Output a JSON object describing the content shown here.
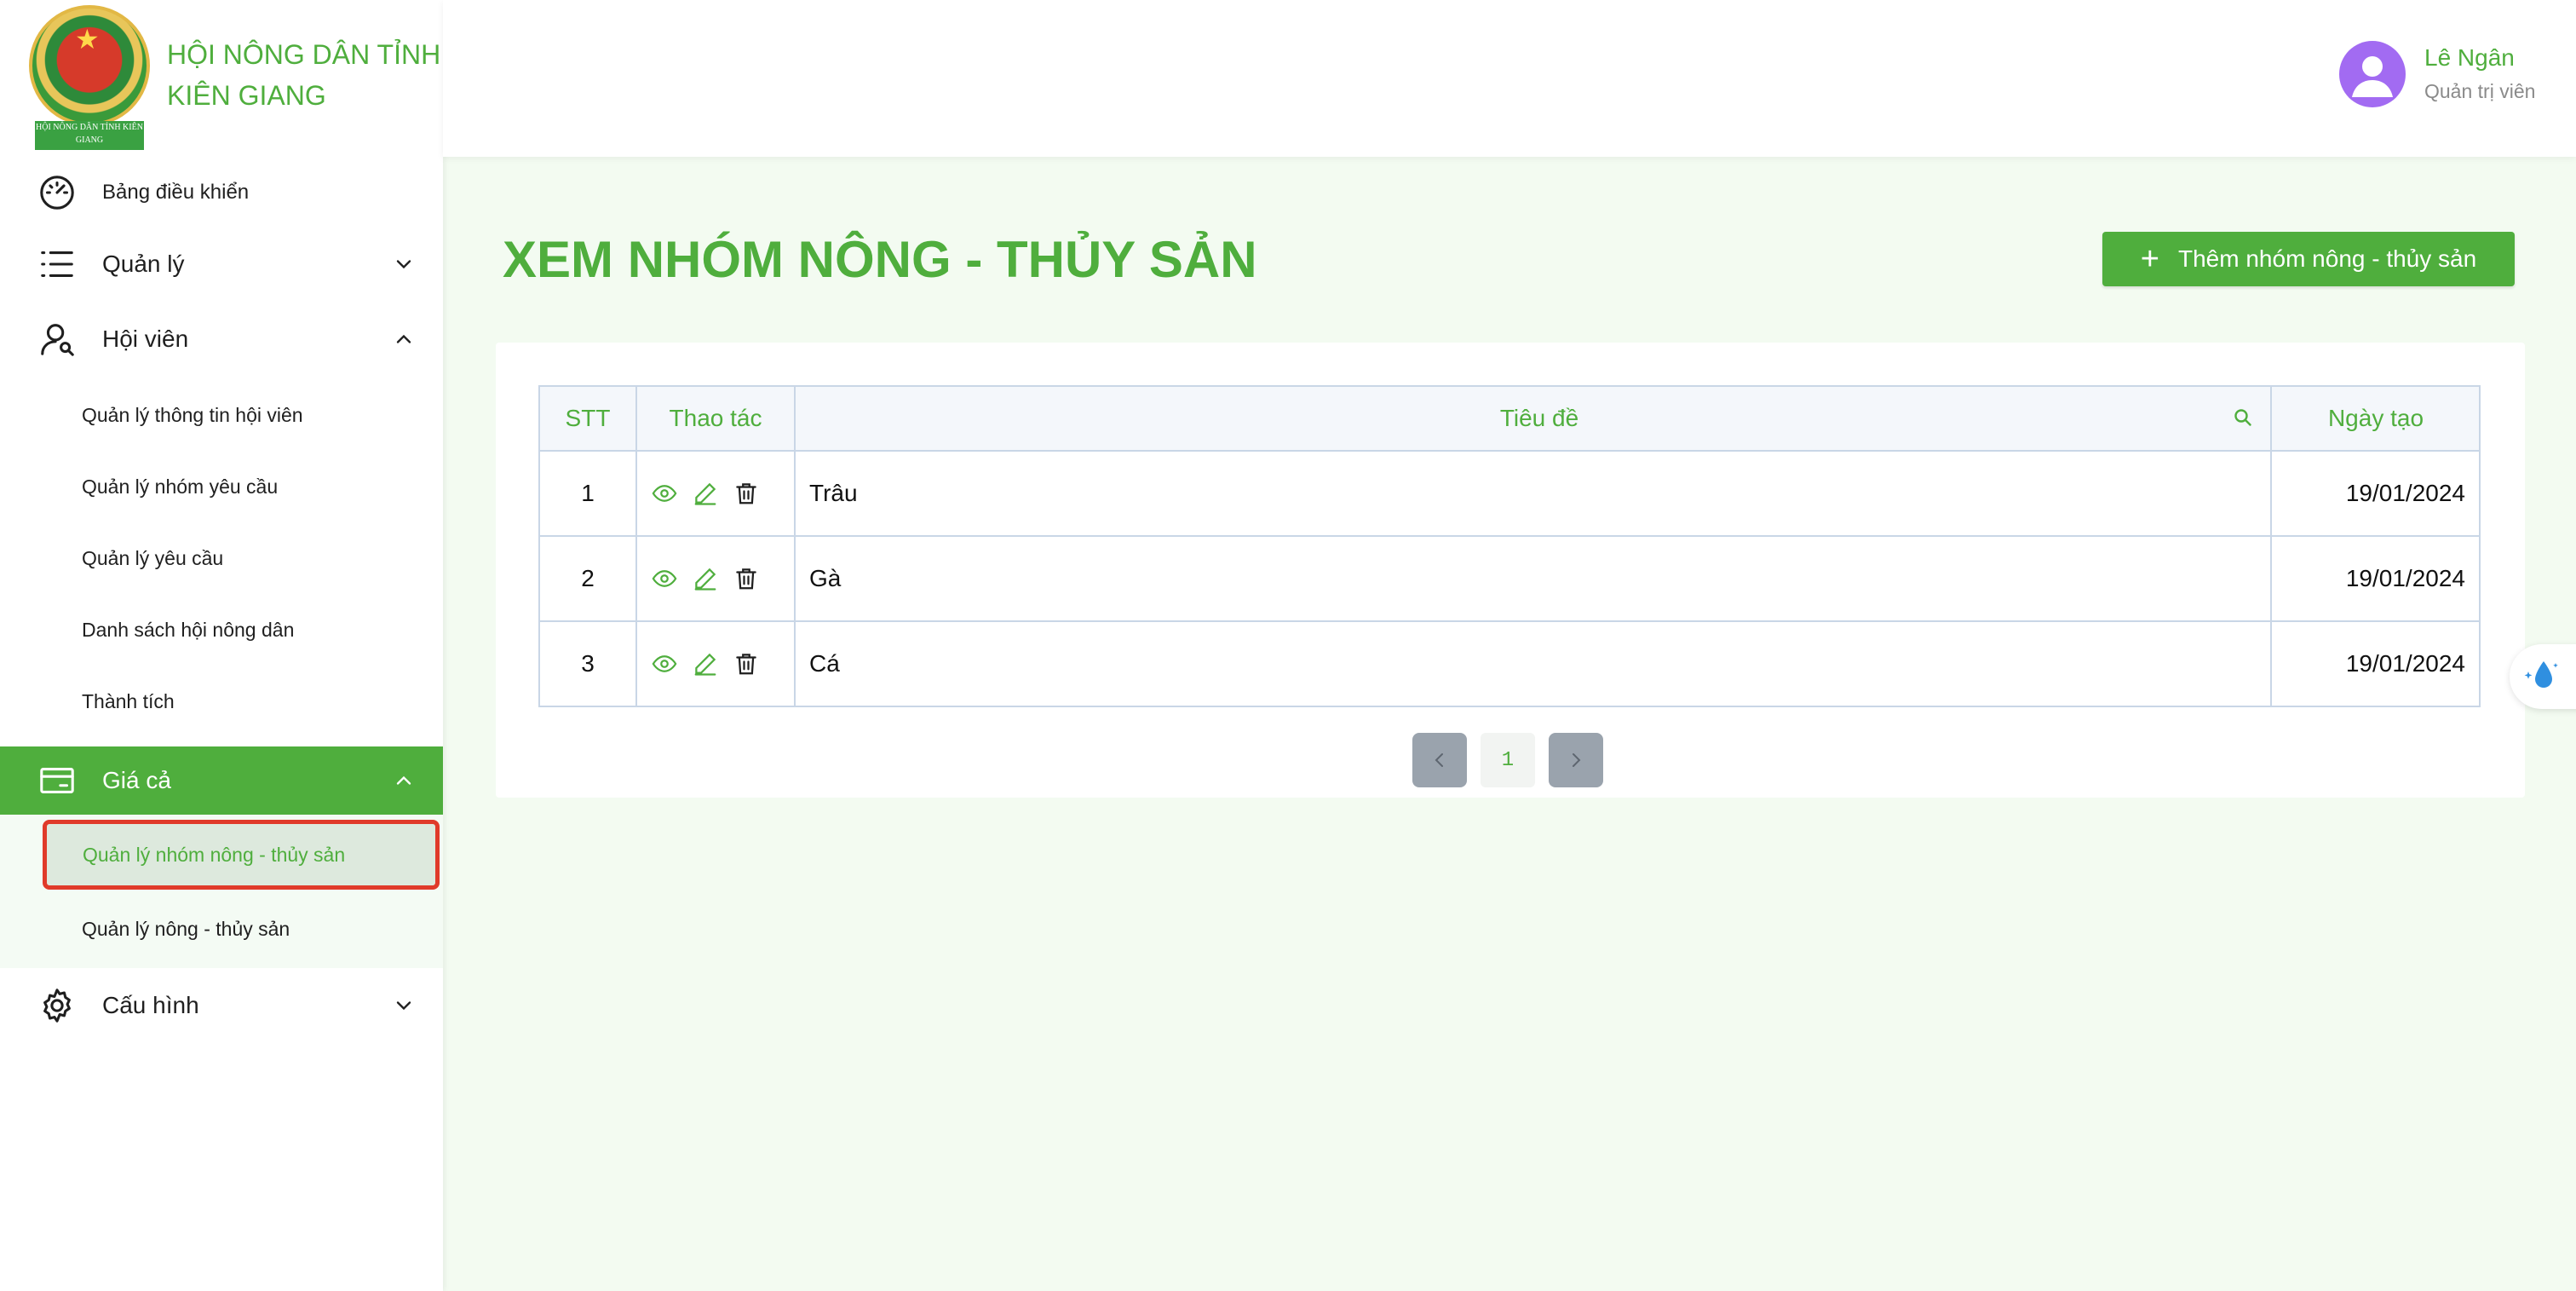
{
  "brand": {
    "name": "HỘI NÔNG DÂN TỈNH KIÊN GIANG",
    "logo_text": "HỘI NÔNG DÂN TỈNH KIÊN GIANG"
  },
  "sidebar": {
    "items": [
      {
        "label": "Bảng điều khiển",
        "icon": "dashboard-gauge-icon"
      },
      {
        "label": "Quản lý",
        "icon": "list-icon",
        "expanded": false
      },
      {
        "label": "Hội viên",
        "icon": "members-icon",
        "expanded": true,
        "children": [
          {
            "label": "Quản lý thông tin hội viên"
          },
          {
            "label": "Quản lý nhóm yêu cầu"
          },
          {
            "label": "Quản lý yêu cầu"
          },
          {
            "label": "Danh sách hội nông dân"
          },
          {
            "label": "Thành tích"
          }
        ]
      },
      {
        "label": "Giá cả",
        "icon": "credit-card-icon",
        "expanded": true,
        "active": true,
        "children": [
          {
            "label": "Quản lý nhóm nông - thủy sản",
            "selected": true
          },
          {
            "label": "Quản lý nông - thủy sản"
          }
        ]
      },
      {
        "label": "Cấu hình",
        "icon": "gear-icon",
        "expanded": false
      }
    ]
  },
  "header": {
    "user_name": "Lê Ngân",
    "user_role": "Quản trị viên"
  },
  "main": {
    "title": "XEM NHÓM NÔNG - THỦY SẢN",
    "add_button_label": "Thêm nhóm nông - thủy sản",
    "table": {
      "headers": [
        "STT",
        "Thao tác",
        "Tiêu đề",
        "Ngày tạo"
      ],
      "rows": [
        {
          "stt": "1",
          "title": "Trâu",
          "created": "19/01/2024"
        },
        {
          "stt": "2",
          "title": "Gà",
          "created": "19/01/2024"
        },
        {
          "stt": "3",
          "title": "Cá",
          "created": "19/01/2024"
        }
      ]
    },
    "pagination": {
      "current_page": "1"
    }
  },
  "colors": {
    "accent": "#4fae3d",
    "avatar": "#a26bf2",
    "selected_outline": "#e03a2a",
    "pager_arrow": "#9aa3ad"
  }
}
